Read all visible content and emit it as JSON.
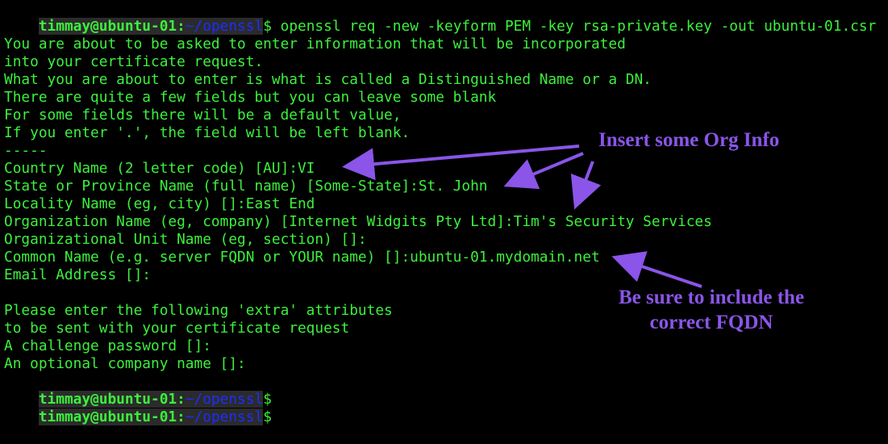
{
  "prompt": {
    "user_host": "timmay@ubuntu-01:",
    "path": "~/openssl",
    "symbol": "$"
  },
  "command": " openssl req -new -keyform PEM -key rsa-private.key -out ubuntu-01.csr",
  "output_lines": [
    "You are about to be asked to enter information that will be incorporated",
    "into your certificate request.",
    "What you are about to enter is what is called a Distinguished Name or a DN.",
    "There are quite a few fields but you can leave some blank",
    "For some fields there will be a default value,",
    "If you enter '.', the field will be left blank.",
    "-----",
    "Country Name (2 letter code) [AU]:VI",
    "State or Province Name (full name) [Some-State]:St. John",
    "Locality Name (eg, city) []:East End",
    "Organization Name (eg, company) [Internet Widgits Pty Ltd]:Tim's Security Services",
    "Organizational Unit Name (eg, section) []:",
    "Common Name (e.g. server FQDN or YOUR name) []:ubuntu-01.mydomain.net",
    "Email Address []:",
    "",
    "Please enter the following 'extra' attributes",
    "to be sent with your certificate request",
    "A challenge password []:",
    "An optional company name []:"
  ],
  "annotations": {
    "org_info": "Insert some Org Info",
    "fqdn_line1": "Be sure to include the",
    "fqdn_line2": "correct FQDN"
  },
  "colors": {
    "background": "#000000",
    "text": "#3cf03c",
    "path": "#1e2cff",
    "annotation": "#8a55e8"
  }
}
